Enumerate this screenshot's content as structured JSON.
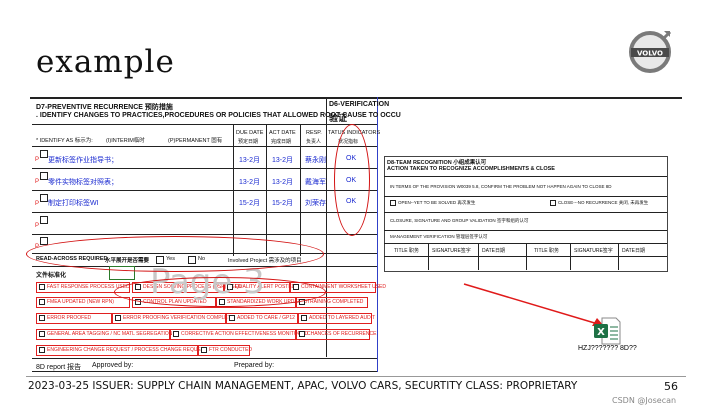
{
  "slide": {
    "title": "example",
    "logo_text": "VOLVO",
    "footer": "2023-03-25  ISSUER: SUPPLY CHAIN MANAGEMENT, APAC, VOLVO CARS, SECURTITY CLASS: PROPRIETARY",
    "page_number": "56",
    "watermark_credit": "CSDN @Josecan"
  },
  "d7": {
    "header": "D7-PREVENTIVE RECURRENCE 预防措施",
    "subheader": ". IDENTIFY CHANGES TO PRACTICES,PROCEDURES OR POLICIES THAT ALLOWED ROOT CAUSE TO OCCU",
    "identify_as": "* IDENTIFY AS 标示为:",
    "interim": "(I)INTERIM临时",
    "permanent": "(P)PERMANENT 固有",
    "col_due": "DUE DATE",
    "col_due_cn": "预定日期",
    "col_act": "ACT DATE",
    "col_act_cn": "完成日期",
    "col_resp": "RESP.",
    "col_resp_cn": "负责人",
    "col_status": "TATUS INDICATORS",
    "col_status_cn": "状况指标",
    "rows": [
      {
        "flag": "P",
        "text": "更新标签作业指导书；",
        "due": "13-2月",
        "act": "13-2月",
        "resp": "蔡永刚",
        "status": "OK"
      },
      {
        "flag": "P",
        "text": "零件实物标签对照表；",
        "due": "13-2月",
        "act": "13-2月",
        "resp": "戴海军",
        "status": "OK"
      },
      {
        "flag": "P",
        "text": "制定打印标签WI",
        "due": "15-2月",
        "act": "15-2月",
        "resp": "刘荣存",
        "status": "OK"
      },
      {
        "flag": "P",
        "text": "",
        "due": "",
        "act": "",
        "resp": "",
        "status": ""
      },
      {
        "flag": "P",
        "text": "",
        "due": "",
        "act": "",
        "resp": "",
        "status": ""
      }
    ],
    "read_across": "READ-ACROSS REQUIRED",
    "read_across_cn": "水平展开是否需要",
    "yes": "Yes",
    "no": "No",
    "involved": "Involved Project 需涉及的项目",
    "docs_label": "文件标准化",
    "docs": [
      [
        "FAST RESPONSE PROCESS USED",
        "DESIGN SOLVING PROCESS (DSP) USED",
        "QUALITY ALERT POSTED",
        "CONTAINMENT WORKSHEET USED"
      ],
      [
        "FMEA UPDATED (NEW RPN)",
        "CONTROL PLAN UPDATED",
        "STANDARDIZED WORK UPDATED",
        "TRAINING COMPLETED"
      ],
      [
        "ERROR PROOFED",
        "ERROR PROOFING VERIFICATION COMPLETE",
        "ADDED TO CARE / GP12",
        "ADDED TO LAYERED AUDIT"
      ],
      [
        "GENERAL AREA TAGGING / NC MATL SEGREGATION",
        "CORRECTIVE ACTION EFFECTIVENESS MONITORED",
        "CHANCES OF RECURRENCE"
      ],
      [
        "ENGINEERING CHANGE REQUEST / PROCESS CHANGE REQUEST",
        "FTR CONDUCTED"
      ]
    ],
    "report_label": "8D report 报告",
    "approved_by": "Approved by:",
    "prepared_by": "Prepared by:",
    "watermark": "Page 3"
  },
  "d6": {
    "header": "D6-VERIFICATION",
    "header_cn": "验证"
  },
  "d8": {
    "header": "D8-TEAM RECOGNITION 小组成果认可",
    "subheader": "ACTION TAKEN TO RECOGNIZE ACCOMPLISHMENTS & CLOSE",
    "provision": "IN TERMS OF THE PROVISION  W0039 5.8, CONFIRM THE PROBLEM NOT HAPPEN AGAIN TO CLOSE 8D",
    "open": "OPEN--YET TO BE SOLVED 再次发生",
    "close": "CLOSE---NO RECURRENCE 关闭, 未再发生",
    "closure": "CLOSURE, SIGNATURE AND GROUP VALIDATION 签字和组的认可",
    "mgmt": "MANAGEMENT VERIFICATION 管理层签字认可",
    "sig_headers": [
      "TITLE 职务",
      "SIGNATURE签字",
      "DATE日期",
      "TITLE 职务",
      "SIGNATURE签字",
      "DATE日期"
    ]
  },
  "attachment": {
    "icon": "excel-file-icon",
    "filename": "HZJ??????? 8D??"
  },
  "colors": {
    "accent_red": "#e01a1a",
    "form_blue": "#1a2ad0",
    "excel_green": "#1e7145"
  }
}
